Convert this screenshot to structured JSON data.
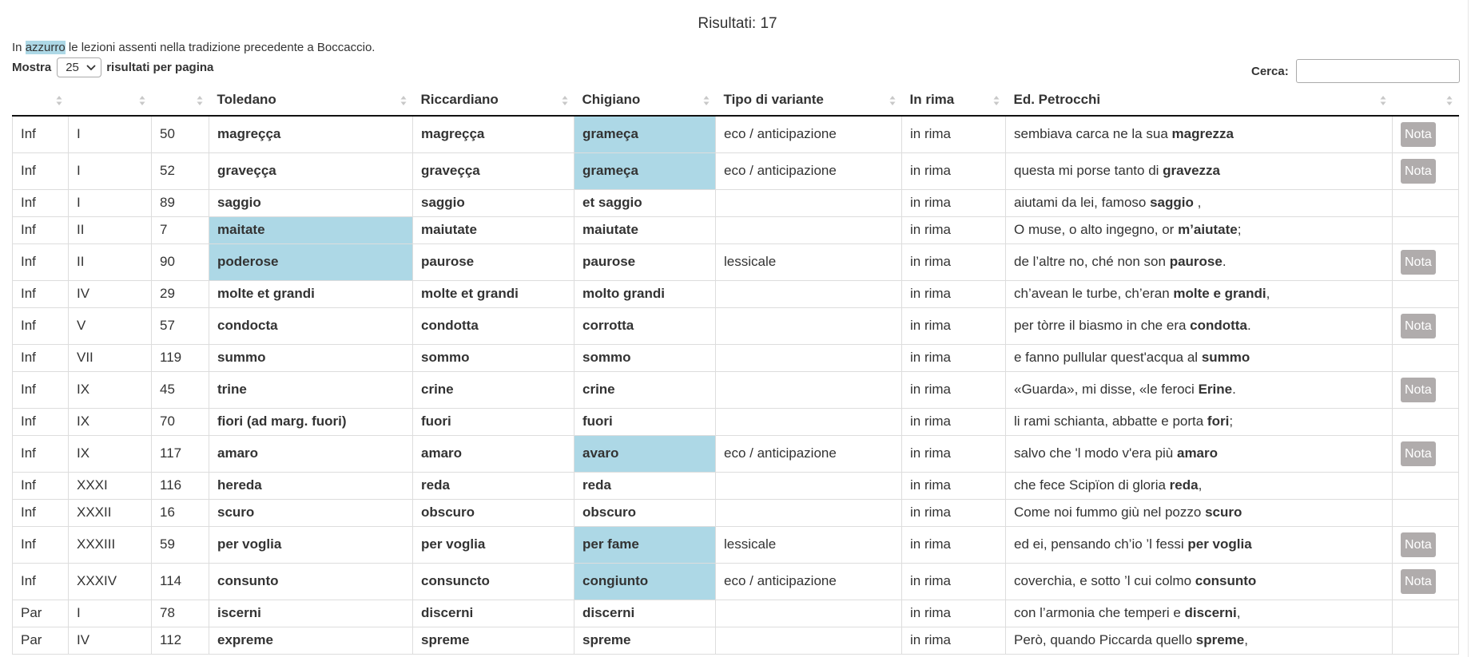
{
  "results_title": "Risultati: 17",
  "legend": {
    "before": "In ",
    "highlight": "azzurro",
    "after": " le lezioni assenti nella tradizione precedente a Boccaccio."
  },
  "length": {
    "prefix": "Mostra",
    "value": "25",
    "suffix": "risultati per pagina"
  },
  "search": {
    "label": "Cerca:",
    "value": ""
  },
  "colors": {
    "highlight": "#add8e6",
    "nota_button": "#b0acac"
  },
  "columns": [
    "",
    "",
    "",
    "Toledano",
    "Riccardiano",
    "Chigiano",
    "Tipo di variante",
    "In rima",
    "Ed. Petrocchi",
    ""
  ],
  "rows": [
    {
      "c1": "Inf",
      "c2": "I",
      "c3": "50",
      "tol": "magreçça",
      "ric": "magreçça",
      "chi": "grameça",
      "tipo": "eco / anticipazione",
      "rima": "in rima",
      "pet_pre": "sembiava carca ne la sua ",
      "pet_b": "magrezza",
      "pet_post": "",
      "nota": "Nota",
      "hl": "chi",
      "tall": true
    },
    {
      "c1": "Inf",
      "c2": "I",
      "c3": "52",
      "tol": "graveçça",
      "ric": "graveçça",
      "chi": "grameça",
      "tipo": "eco / anticipazione",
      "rima": "in rima",
      "pet_pre": "questa mi porse tanto di ",
      "pet_b": "gravezza",
      "pet_post": "",
      "nota": "Nota",
      "hl": "chi",
      "tall": true
    },
    {
      "c1": "Inf",
      "c2": "I",
      "c3": "89",
      "tol": "saggio",
      "ric": "saggio",
      "chi": "et saggio",
      "tipo": "",
      "rima": "in rima",
      "pet_pre": "aiutami da lei, famoso ",
      "pet_b": "saggio",
      "pet_post": " ,",
      "nota": "",
      "hl": "",
      "tall": false
    },
    {
      "c1": "Inf",
      "c2": "II",
      "c3": "7",
      "tol": "maitate",
      "ric": "maiutate",
      "chi": "maiutate",
      "tipo": "",
      "rima": "in rima",
      "pet_pre": "O muse, o alto ingegno, or ",
      "pet_b": "m’aiutate",
      "pet_post": ";",
      "nota": "",
      "hl": "tol",
      "tall": false
    },
    {
      "c1": "Inf",
      "c2": "II",
      "c3": "90",
      "tol": "poderose",
      "ric": "paurose",
      "chi": "paurose",
      "tipo": "lessicale",
      "rima": "in rima",
      "pet_pre": "de l’altre no, ché non son ",
      "pet_b": "paurose",
      "pet_post": ".",
      "nota": "Nota",
      "hl": "tol",
      "tall": true
    },
    {
      "c1": "Inf",
      "c2": "IV",
      "c3": "29",
      "tol": "molte et grandi",
      "ric": "molte et grandi",
      "chi": "molto grandi",
      "tipo": "",
      "rima": "in rima",
      "pet_pre": "ch’avean le turbe, ch’eran ",
      "pet_b": "molte e grandi",
      "pet_post": ",",
      "nota": "",
      "hl": "",
      "tall": false
    },
    {
      "c1": "Inf",
      "c2": "V",
      "c3": "57",
      "tol": "condocta",
      "ric": "condotta",
      "chi": "corrotta",
      "tipo": "",
      "rima": "in rima",
      "pet_pre": "per tòrre il biasmo in che era ",
      "pet_b": "condotta",
      "pet_post": ".",
      "nota": "Nota",
      "hl": "",
      "tall": true
    },
    {
      "c1": "Inf",
      "c2": "VII",
      "c3": "119",
      "tol": "summo",
      "ric": "sommo",
      "chi": "sommo",
      "tipo": "",
      "rima": "in rima",
      "pet_pre": "e fanno pullular quest'acqua al ",
      "pet_b": "summo",
      "pet_post": "",
      "nota": "",
      "hl": "",
      "tall": false
    },
    {
      "c1": "Inf",
      "c2": "IX",
      "c3": "45",
      "tol": "trine",
      "ric": "crine",
      "chi": "crine",
      "tipo": "",
      "rima": "in rima",
      "pet_pre": "«Guarda», mi disse, «le feroci ",
      "pet_b": "Erine",
      "pet_post": ".",
      "nota": "Nota",
      "hl": "",
      "tall": true
    },
    {
      "c1": "Inf",
      "c2": "IX",
      "c3": "70",
      "tol": "fiori (ad marg. fuori)",
      "ric": "fuori",
      "chi": "fuori",
      "tipo": "",
      "rima": "in rima",
      "pet_pre": "li rami schianta, abbatte e porta ",
      "pet_b": "fori",
      "pet_post": ";",
      "nota": "",
      "hl": "",
      "tall": false
    },
    {
      "c1": "Inf",
      "c2": "IX",
      "c3": "117",
      "tol": "amaro",
      "ric": "amaro",
      "chi": "avaro",
      "tipo": "eco / anticipazione",
      "rima": "in rima",
      "pet_pre": "salvo che 'l modo v'era più ",
      "pet_b": "amaro",
      "pet_post": "",
      "nota": "Nota",
      "hl": "chi",
      "tall": true
    },
    {
      "c1": "Inf",
      "c2": "XXXI",
      "c3": "116",
      "tol": "hereda",
      "ric": "reda",
      "chi": "reda",
      "tipo": "",
      "rima": "in rima",
      "pet_pre": "che fece Scipïon di gloria ",
      "pet_b": "reda",
      "pet_post": ",",
      "nota": "",
      "hl": "",
      "tall": false
    },
    {
      "c1": "Inf",
      "c2": "XXXII",
      "c3": "16",
      "tol": "scuro",
      "ric": "obscuro",
      "chi": "obscuro",
      "tipo": "",
      "rima": "in rima",
      "pet_pre": "Come noi fummo giù nel pozzo ",
      "pet_b": "scuro",
      "pet_post": "",
      "nota": "",
      "hl": "",
      "tall": false
    },
    {
      "c1": "Inf",
      "c2": "XXXIII",
      "c3": "59",
      "tol": "per voglia",
      "ric": "per voglia",
      "chi": "per fame",
      "tipo": "lessicale",
      "rima": "in rima",
      "pet_pre": "ed ei, pensando ch’io ’l fessi ",
      "pet_b": "per voglia",
      "pet_post": "",
      "nota": "Nota",
      "hl": "chi",
      "tall": true
    },
    {
      "c1": "Inf",
      "c2": "XXXIV",
      "c3": "114",
      "tol": "consunto",
      "ric": "consuncto",
      "chi": "congiunto",
      "tipo": "eco / anticipazione",
      "rima": "in rima",
      "pet_pre": "coverchia, e sotto ’l cui colmo ",
      "pet_b": "consunto",
      "pet_post": "",
      "nota": "Nota",
      "hl": "chi",
      "tall": true
    },
    {
      "c1": "Par",
      "c2": "I",
      "c3": "78",
      "tol": "iscerni",
      "ric": "discerni",
      "chi": "discerni",
      "tipo": "",
      "rima": "in rima",
      "pet_pre": "con l’armonia che temperi e ",
      "pet_b": "discerni",
      "pet_post": ",",
      "nota": "",
      "hl": "",
      "tall": false
    },
    {
      "c1": "Par",
      "c2": "IV",
      "c3": "112",
      "tol": "expreme",
      "ric": "spreme",
      "chi": "spreme",
      "tipo": "",
      "rima": "in rima",
      "pet_pre": "Però, quando Piccarda quello ",
      "pet_b": "spreme",
      "pet_post": ",",
      "nota": "",
      "hl": "",
      "tall": false
    }
  ]
}
